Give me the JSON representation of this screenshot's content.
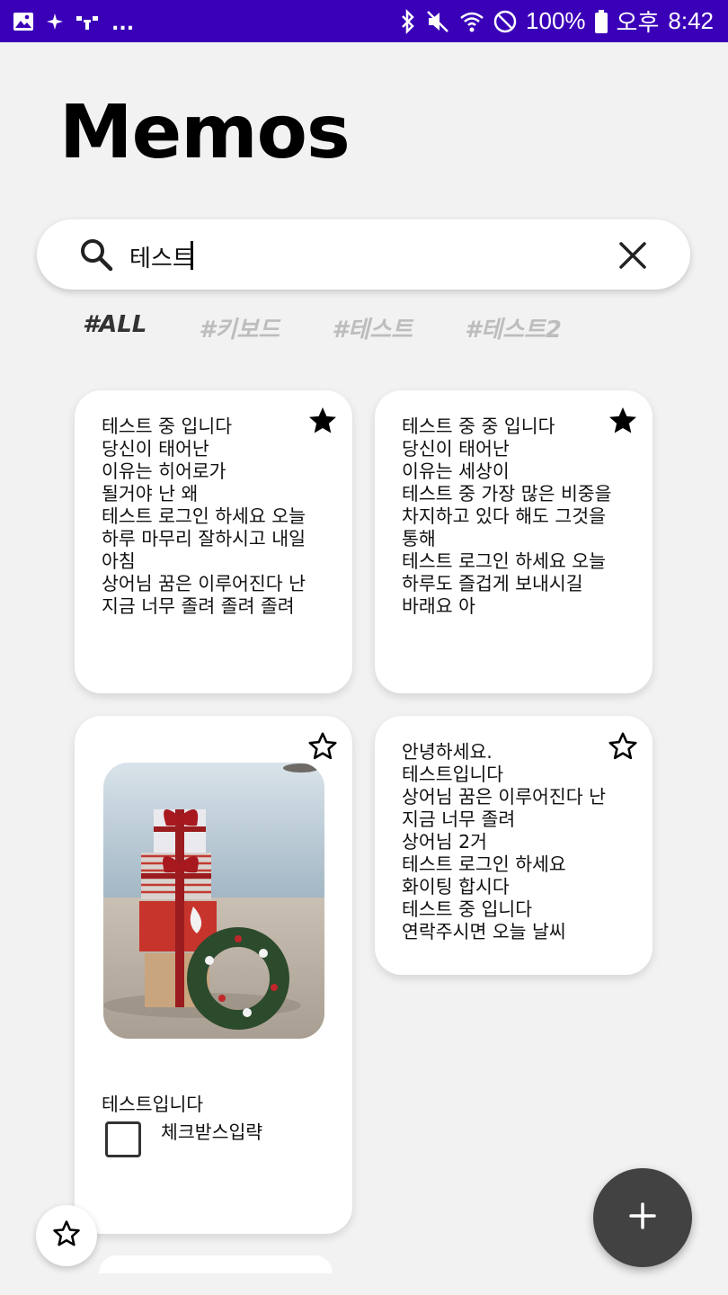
{
  "status_bar": {
    "battery": "100%",
    "ampm": "오후",
    "time": "8:42",
    "icons": [
      "gallery-icon",
      "sparkle-icon",
      "sim-icon",
      "more-dots-icon",
      "bluetooth-icon",
      "mute-icon",
      "wifi-icon",
      "block-icon",
      "battery-icon"
    ],
    "dots": "..."
  },
  "header": {
    "title": "Memos"
  },
  "search": {
    "value": "테스트",
    "placeholder": ""
  },
  "tags": [
    "#ALL",
    "#키보드",
    "#테스트",
    "#테스트2"
  ],
  "memos": [
    {
      "starred": true,
      "text": "테스트 중 입니다\n당신이 태어난\n이유는 히어로가\n될거야 난 왜\n테스트 로그인 하세요 오늘\n하루 마무리 잘하시고 내일\n아침\n상어님 꿈은 이루어진다 난\n지금 너무 졸려 졸려 졸려"
    },
    {
      "starred": true,
      "text": "테스트 중 중 입니다\n당신이 태어난\n이유는 세상이\n테스트 중 가장 많은 비중을\n차지하고 있다 해도 그것을\n통해\n테스트 로그인 하세요 오늘\n하루도 즐겁게 보내시길\n바래요 아"
    },
    {
      "starred": false,
      "has_image": true,
      "text": "테스트입니다",
      "checkbox_label": "체크받스입략",
      "checked": false
    },
    {
      "starred": false,
      "text": "안녕하세요.\n테스트입니다\n상어님 꿈은 이루어진다 난\n지금 너무 졸려\n상어님 2거\n테스트 로그인 하세요\n화이팅 합시다\n테스트 중 입니다\n연락주시면 오늘 날씨"
    }
  ],
  "colors": {
    "status_bar": "#3a00b8",
    "fab": "#424242",
    "background": "#f2f2f2"
  }
}
